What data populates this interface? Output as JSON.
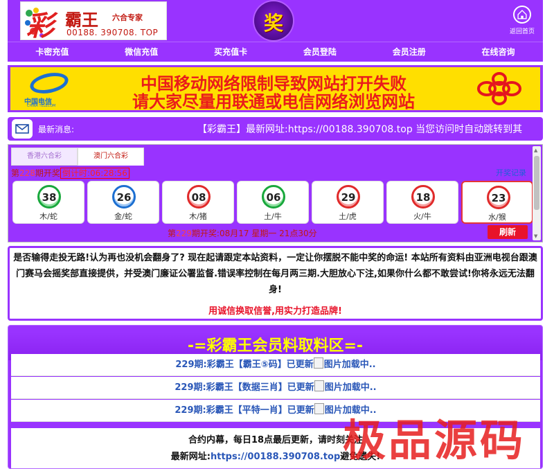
{
  "header": {
    "logo_char": "彩",
    "logo_name": "霸王",
    "logo_sub": "六合专家",
    "logo_url": "00188. 390708. TOP",
    "center_char": "奖",
    "home_label": "返回首页"
  },
  "nav": [
    "卡密充值",
    "微信充值",
    "买充值卡",
    "会员登陆",
    "会员注册",
    "在线咨询"
  ],
  "banner": {
    "line1": "中国移动网络限制导致网站打开失败",
    "line2": "请大家尽量用联通或电信网络浏览网站",
    "telecom_cn": "中国电信",
    "telecom_en": "CHINA TELECOM"
  },
  "news": {
    "label": "最新消息:",
    "text": "【彩霸王】最新网址:https://00188.390708.top 当您访问时自动跳转到其"
  },
  "lottery": {
    "tabs": [
      "香港六合彩",
      "澳门六合彩"
    ],
    "active_tab": 1,
    "current_prefix": "第",
    "current_issue": "228",
    "current_suffix": "期开奖",
    "countdown": "倒计时:06:28:56",
    "history_label": "开奖记录",
    "balls": [
      {
        "number": "38",
        "zodiac": "木/蛇",
        "color": "green"
      },
      {
        "number": "26",
        "zodiac": "金/蛇",
        "color": "blue"
      },
      {
        "number": "08",
        "zodiac": "木/猪",
        "color": "red"
      },
      {
        "number": "06",
        "zodiac": "土/牛",
        "color": "green"
      },
      {
        "number": "29",
        "zodiac": "土/虎",
        "color": "red"
      },
      {
        "number": "18",
        "zodiac": "火/牛",
        "color": "red"
      },
      {
        "number": "23",
        "zodiac": "水/猴",
        "color": "red",
        "special": true
      }
    ],
    "next_prefix": "第",
    "next_issue": "229",
    "next_suffix": "期开奖:08月17 星期一 21点30分",
    "refresh_label": "刷新"
  },
  "intro": {
    "text": "是否输得走投无路!认为再也没机会翻身了? 现在起请跟定本站资料，一定让你摆脱不能中奖的命运! 本站所有资料由亚洲电视台跟澳门赛马会摇奖部直接提供，并受澳门廉证公署监督.错误率控制在每月两三期.大胆放心下注,如果你什么都不敢尝试!你将永远无法翻身!",
    "slogan": "用诚信换取信誉,用实力打造品牌!"
  },
  "member": {
    "title": "-=彩霸王会员料取料区=-",
    "items": [
      {
        "text": "229期:彩霸王【霸王⑤码】已更新",
        "img_alt": "图片加载中.."
      },
      {
        "text": "229期:彩霸王【数据三肖】已更新",
        "img_alt": "图片加载中.."
      },
      {
        "text": "229期:彩霸王【平特一肖】已更新",
        "img_alt": "图片加载中.."
      }
    ],
    "footer_line1": "合约内幕，每日18点最后更新，请时刻关注",
    "footer_prefix": "最新网址:",
    "footer_url": "https://00188.390708.top",
    "footer_suffix": "避免遗失!"
  },
  "watermark": "极品源码",
  "colors": {
    "purple": "#9933ff",
    "banner_yellow": "#ffdf00",
    "banner_red": "#ea1b1b",
    "title_yellow": "#ffff00",
    "link_blue": "#2a57b8"
  }
}
